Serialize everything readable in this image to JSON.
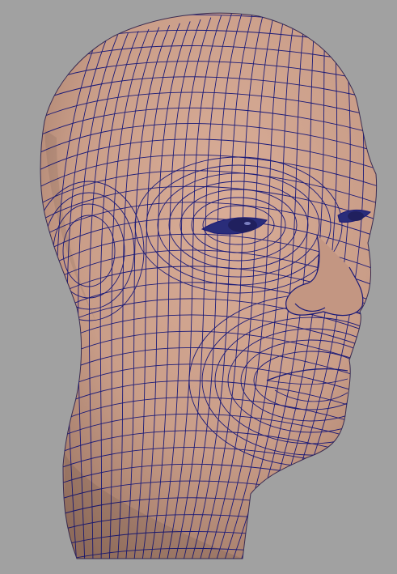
{
  "viewport": {
    "background_color": "#a1a1a1",
    "model_surface_color": "#c99d88",
    "model_shadow_color": "#9b7563",
    "wireframe_color": "#1a1a78",
    "eye_color": "#2a2d7a",
    "shading": "smooth-shaded-with-wireframe",
    "object_icon": "head-mesh-icon"
  }
}
